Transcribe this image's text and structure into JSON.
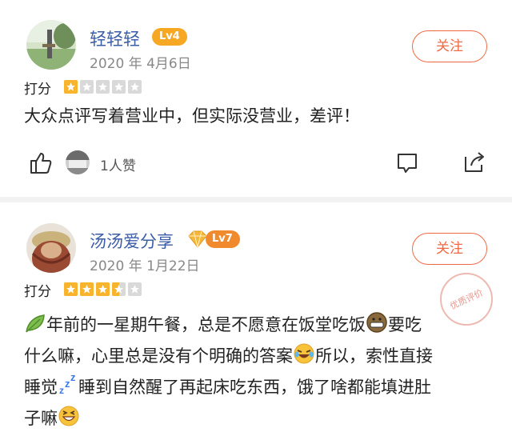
{
  "reviews": [
    {
      "username": "轻轻轻",
      "level": "Lv4",
      "date": "2020 年 4月6日",
      "follow_label": "关注",
      "rating_label": "打分",
      "rating": 1,
      "text": "大众点评写着营业中，但实际没营业，差评！",
      "likes_text": "1人赞"
    },
    {
      "username": "汤汤爱分享",
      "level": "Lv7",
      "date": "2020 年 1月22日",
      "follow_label": "关注",
      "rating_label": "打分",
      "rating": 3.5,
      "text_lines": [
        "年前的一星期午餐，总是不愿意在饭堂吃饭",
        "要吃",
        "什么嘛，心里总是没有个明确的答案",
        "所以，索性直接",
        "睡觉",
        "睡到自然醒了再起床吃东西，饿了啥都能填进肚",
        "子嘛"
      ],
      "stamp_text": "优质评价"
    }
  ],
  "colors": {
    "accent": "#f06a45",
    "username": "#3b5ea6",
    "level": "#f7a823",
    "star": "#f7b42c"
  },
  "icons": [
    "thumbs-up-icon",
    "comment-icon",
    "share-icon",
    "diamond-icon",
    "leaf-emoji",
    "grin-emoji",
    "laugh-cry-emoji",
    "zzz-emoji",
    "grin-squint-emoji"
  ]
}
